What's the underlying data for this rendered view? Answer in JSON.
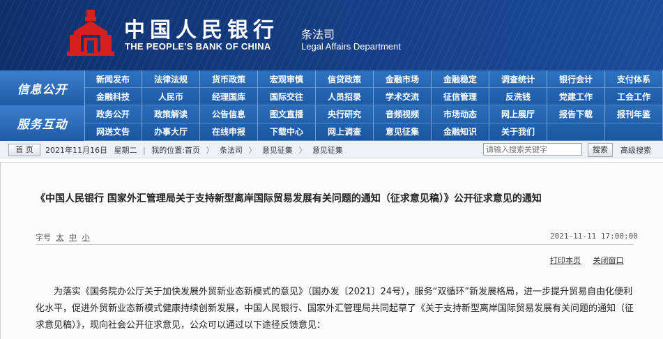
{
  "header": {
    "bank_name_cn": "中国人民银行",
    "bank_name_en": "THE PEOPLE'S BANK OF CHINA",
    "dept_cn": "条法司",
    "dept_en": "Legal Affairs Department",
    "colors": {
      "banner": "#143c82",
      "nav": "#2366b3",
      "logo": "#d62020"
    }
  },
  "nav": {
    "info_title": "信息公开",
    "info_items": [
      "新闻发布",
      "法律法规",
      "货币政策",
      "宏观审慎",
      "信贷政策",
      "金融市场",
      "金融稳定",
      "调查统计",
      "银行会计",
      "支付体系",
      "金融科技",
      "人民币",
      "经理国库",
      "国际交往",
      "人员招录",
      "学术交流",
      "征信管理",
      "反洗钱",
      "党建工作",
      "工会工作"
    ],
    "service_title": "服务互动",
    "service_items": [
      "政务公开",
      "政策解读",
      "公告信息",
      "图文直播",
      "央行研究",
      "音频视频",
      "市场动态",
      "网上展厅",
      "报告下载",
      "报刊年鉴",
      "网送文告",
      "办事大厅",
      "在线申报",
      "下载中心",
      "网上调查",
      "意见征集",
      "金融知识",
      "关于我们",
      "",
      ""
    ]
  },
  "breadcrumb": {
    "home_button": "首 页",
    "date": "2021年11月16日",
    "weekday": "星期二",
    "location_label": "我的位置:首页",
    "items": [
      "条法司",
      "意见征集",
      "意见征集"
    ],
    "separator": "〉"
  },
  "search": {
    "placeholder": "请输入搜索关键字",
    "button": "搜索",
    "advanced": "高级搜索"
  },
  "article": {
    "title": "《中国人民银行 国家外汇管理局关于支持新型离岸国际贸易发展有关问题的通知（征求意见稿）》公开征求意见的通知",
    "font_size_label": "字号",
    "font_sizes": [
      "太",
      "中",
      "小"
    ],
    "datetime": "2021-11-11 17:00:00",
    "print_label": "打印本页",
    "close_label": "关闭窗口",
    "paragraph": "为落实《国务院办公厅关于加快发展外贸新业态新模式的意见》（国办发〔2021〕24号），服务“双循环”新发展格局，进一步提升贸易自由化便利化水平，促进外贸新业态新模式健康持续创新发展，中国人民银行、国家外汇管理局共同起草了《关于支持新型离岸国际贸易发展有关问题的通知（征求意见稿）》，现向社会公开征求意见，公众可以通过以下途径反馈意见："
  }
}
